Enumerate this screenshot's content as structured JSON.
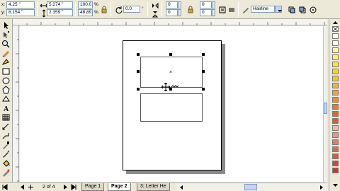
{
  "property_bar": {
    "x_label": "x:",
    "x_value": "4.25 \"",
    "y_label": "y:",
    "y_value": "8.154 \"",
    "width_value": "5.274 \"",
    "height_value": "2.359 \"",
    "scale_x": "100.0",
    "scale_y": "48.89",
    "scale_unit": "%",
    "rotation_value": "0.0",
    "rotation_unit": "°",
    "corner_tl": "0",
    "corner_tr": "0",
    "corner_bl": "0",
    "corner_br": "0",
    "outline_width": "Hairline"
  },
  "pages": {
    "count_label": "2 of 4",
    "tabs": [
      {
        "label": "Page 1",
        "active": false
      },
      {
        "label": "Page 2",
        "active": true
      },
      {
        "label": "3: Letter He",
        "active": false
      }
    ]
  },
  "palette_colors": [
    "#ffffff",
    "#fffde0",
    "#fff8a8",
    "#fff06a",
    "#ffe13a",
    "#ffd700",
    "#f4c430",
    "#f0b040",
    "#f0a040",
    "#f08c30",
    "#e87a28",
    "#e06828",
    "#d85c30",
    "#f0b8a0",
    "#e89880",
    "#e08060",
    "#d86c50",
    "#d05c40",
    "#c44c38",
    "#b84030"
  ],
  "cursor_text": "↑↓ \\u00b9·4"
}
